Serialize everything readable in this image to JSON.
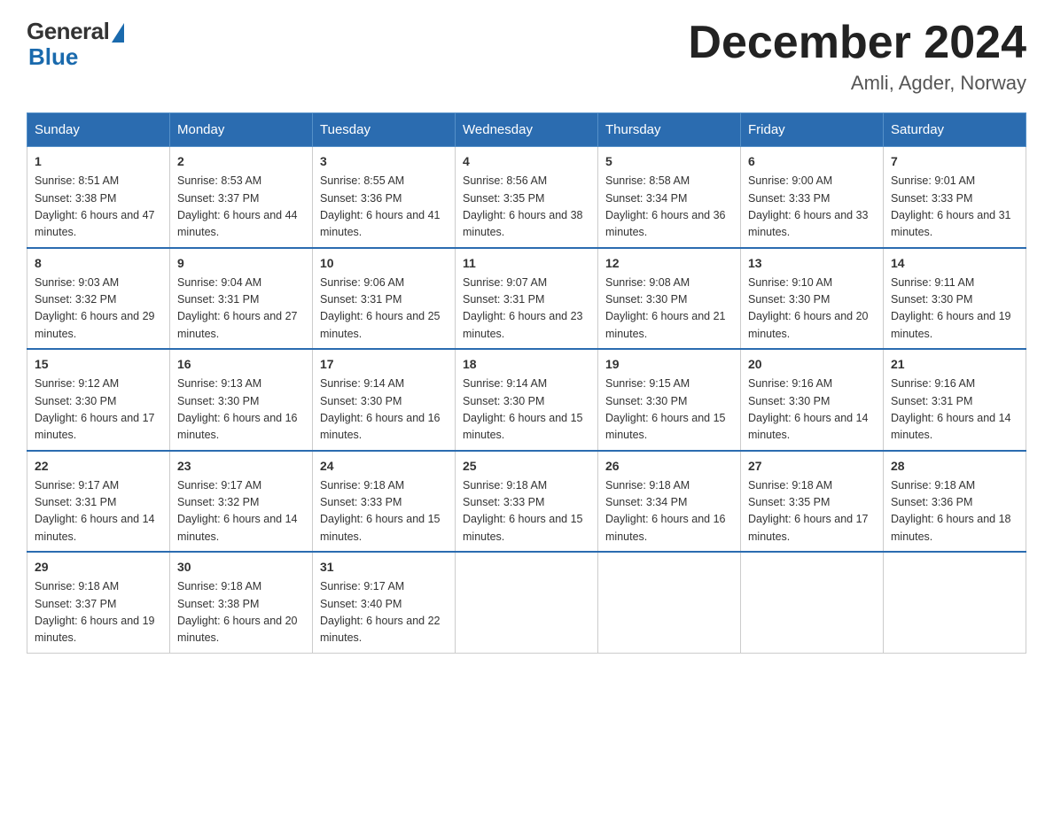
{
  "header": {
    "logo_general": "General",
    "logo_blue": "Blue",
    "month_title": "December 2024",
    "subtitle": "Amli, Agder, Norway"
  },
  "days_of_week": [
    "Sunday",
    "Monday",
    "Tuesday",
    "Wednesday",
    "Thursday",
    "Friday",
    "Saturday"
  ],
  "weeks": [
    [
      {
        "day": "1",
        "sunrise": "8:51 AM",
        "sunset": "3:38 PM",
        "daylight": "6 hours and 47 minutes."
      },
      {
        "day": "2",
        "sunrise": "8:53 AM",
        "sunset": "3:37 PM",
        "daylight": "6 hours and 44 minutes."
      },
      {
        "day": "3",
        "sunrise": "8:55 AM",
        "sunset": "3:36 PM",
        "daylight": "6 hours and 41 minutes."
      },
      {
        "day": "4",
        "sunrise": "8:56 AM",
        "sunset": "3:35 PM",
        "daylight": "6 hours and 38 minutes."
      },
      {
        "day": "5",
        "sunrise": "8:58 AM",
        "sunset": "3:34 PM",
        "daylight": "6 hours and 36 minutes."
      },
      {
        "day": "6",
        "sunrise": "9:00 AM",
        "sunset": "3:33 PM",
        "daylight": "6 hours and 33 minutes."
      },
      {
        "day": "7",
        "sunrise": "9:01 AM",
        "sunset": "3:33 PM",
        "daylight": "6 hours and 31 minutes."
      }
    ],
    [
      {
        "day": "8",
        "sunrise": "9:03 AM",
        "sunset": "3:32 PM",
        "daylight": "6 hours and 29 minutes."
      },
      {
        "day": "9",
        "sunrise": "9:04 AM",
        "sunset": "3:31 PM",
        "daylight": "6 hours and 27 minutes."
      },
      {
        "day": "10",
        "sunrise": "9:06 AM",
        "sunset": "3:31 PM",
        "daylight": "6 hours and 25 minutes."
      },
      {
        "day": "11",
        "sunrise": "9:07 AM",
        "sunset": "3:31 PM",
        "daylight": "6 hours and 23 minutes."
      },
      {
        "day": "12",
        "sunrise": "9:08 AM",
        "sunset": "3:30 PM",
        "daylight": "6 hours and 21 minutes."
      },
      {
        "day": "13",
        "sunrise": "9:10 AM",
        "sunset": "3:30 PM",
        "daylight": "6 hours and 20 minutes."
      },
      {
        "day": "14",
        "sunrise": "9:11 AM",
        "sunset": "3:30 PM",
        "daylight": "6 hours and 19 minutes."
      }
    ],
    [
      {
        "day": "15",
        "sunrise": "9:12 AM",
        "sunset": "3:30 PM",
        "daylight": "6 hours and 17 minutes."
      },
      {
        "day": "16",
        "sunrise": "9:13 AM",
        "sunset": "3:30 PM",
        "daylight": "6 hours and 16 minutes."
      },
      {
        "day": "17",
        "sunrise": "9:14 AM",
        "sunset": "3:30 PM",
        "daylight": "6 hours and 16 minutes."
      },
      {
        "day": "18",
        "sunrise": "9:14 AM",
        "sunset": "3:30 PM",
        "daylight": "6 hours and 15 minutes."
      },
      {
        "day": "19",
        "sunrise": "9:15 AM",
        "sunset": "3:30 PM",
        "daylight": "6 hours and 15 minutes."
      },
      {
        "day": "20",
        "sunrise": "9:16 AM",
        "sunset": "3:30 PM",
        "daylight": "6 hours and 14 minutes."
      },
      {
        "day": "21",
        "sunrise": "9:16 AM",
        "sunset": "3:31 PM",
        "daylight": "6 hours and 14 minutes."
      }
    ],
    [
      {
        "day": "22",
        "sunrise": "9:17 AM",
        "sunset": "3:31 PM",
        "daylight": "6 hours and 14 minutes."
      },
      {
        "day": "23",
        "sunrise": "9:17 AM",
        "sunset": "3:32 PM",
        "daylight": "6 hours and 14 minutes."
      },
      {
        "day": "24",
        "sunrise": "9:18 AM",
        "sunset": "3:33 PM",
        "daylight": "6 hours and 15 minutes."
      },
      {
        "day": "25",
        "sunrise": "9:18 AM",
        "sunset": "3:33 PM",
        "daylight": "6 hours and 15 minutes."
      },
      {
        "day": "26",
        "sunrise": "9:18 AM",
        "sunset": "3:34 PM",
        "daylight": "6 hours and 16 minutes."
      },
      {
        "day": "27",
        "sunrise": "9:18 AM",
        "sunset": "3:35 PM",
        "daylight": "6 hours and 17 minutes."
      },
      {
        "day": "28",
        "sunrise": "9:18 AM",
        "sunset": "3:36 PM",
        "daylight": "6 hours and 18 minutes."
      }
    ],
    [
      {
        "day": "29",
        "sunrise": "9:18 AM",
        "sunset": "3:37 PM",
        "daylight": "6 hours and 19 minutes."
      },
      {
        "day": "30",
        "sunrise": "9:18 AM",
        "sunset": "3:38 PM",
        "daylight": "6 hours and 20 minutes."
      },
      {
        "day": "31",
        "sunrise": "9:17 AM",
        "sunset": "3:40 PM",
        "daylight": "6 hours and 22 minutes."
      },
      null,
      null,
      null,
      null
    ]
  ]
}
